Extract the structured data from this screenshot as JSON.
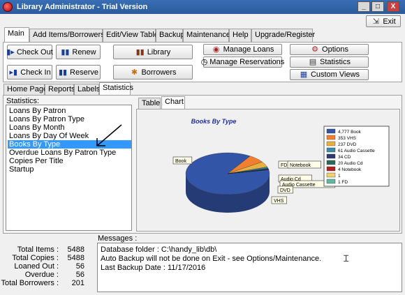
{
  "window": {
    "title": "Library Administrator - Trial Version",
    "minimize_label": "_",
    "maximize_label": "□",
    "close_label": "X",
    "exit_label": "Exit"
  },
  "menu_tabs": [
    "Main",
    "Add Items/Borrowers",
    "Edit/View Table",
    "Backup",
    "Maintenance",
    "Help",
    "Upgrade/Register"
  ],
  "toolbar": {
    "check_out": "Check Out",
    "check_in": "Check In",
    "renew": "Renew",
    "reserve": "Reserve",
    "library": "Library",
    "borrowers": "Borrowers",
    "manage_loans": "Manage Loans",
    "manage_reservations": "Manage Reservations",
    "options": "Options",
    "statistics": "Statistics",
    "custom_views": "Custom Views"
  },
  "sub_tabs": [
    "Home Page",
    "Reports",
    "Labels",
    "Statistics"
  ],
  "statistics_label": "Statistics:",
  "statistics_list": [
    "Loans By Patron",
    "Loans By Patron Type",
    "Loans By Month",
    "Loans By Day Of Week",
    "Books By Type",
    "Overdue Loans By Patron Type",
    "Copies Per Title",
    "Startup"
  ],
  "selected_stat_index": 4,
  "chart_tabs": [
    "Table",
    "Chart"
  ],
  "chart_data": {
    "type": "pie",
    "title": "Books By Type",
    "categories": [
      "Book",
      "VHS",
      "DVD",
      "Audio Cassette",
      "CD",
      "Audio Cd",
      "Notebook",
      "",
      "FD"
    ],
    "values": [
      4777,
      353,
      237,
      61,
      34,
      20,
      4,
      1,
      1
    ],
    "legend_entries": [
      "4,777 Book",
      "353 VHS",
      "237 DVD",
      "61 Audio Cassette",
      "34 CD",
      "20 Audio Cd",
      "4 Notebook",
      "1",
      "1 FD"
    ],
    "colors": [
      "#3355a8",
      "#f08030",
      "#e8b040",
      "#3a8aa8",
      "#2c3a70",
      "#2a6a5a",
      "#b02020",
      "#f0d070",
      "#60b8a0"
    ],
    "slice_labels": [
      "Book",
      "FD",
      "Notebook",
      "Audio Cd",
      "Audio Cassette",
      "DVD",
      "VHS"
    ],
    "legend_position": "right"
  },
  "totals": {
    "items_label": "Total Items :",
    "items_value": "5488",
    "copies_label": "Total Copies :",
    "copies_value": "5488",
    "loaned_label": "Loaned Out :",
    "loaned_value": "56",
    "overdue_label": "Overdue :",
    "overdue_value": "56",
    "borrowers_label": "Total Borrowers :",
    "borrowers_value": "201"
  },
  "messages": {
    "label": "Messages :",
    "lines": [
      "Database folder : C:\\handy_lib\\db\\",
      "Auto Backup will not be done on Exit - see Options/Maintenance.",
      "Last Backup Date : 11/17/2016"
    ]
  }
}
